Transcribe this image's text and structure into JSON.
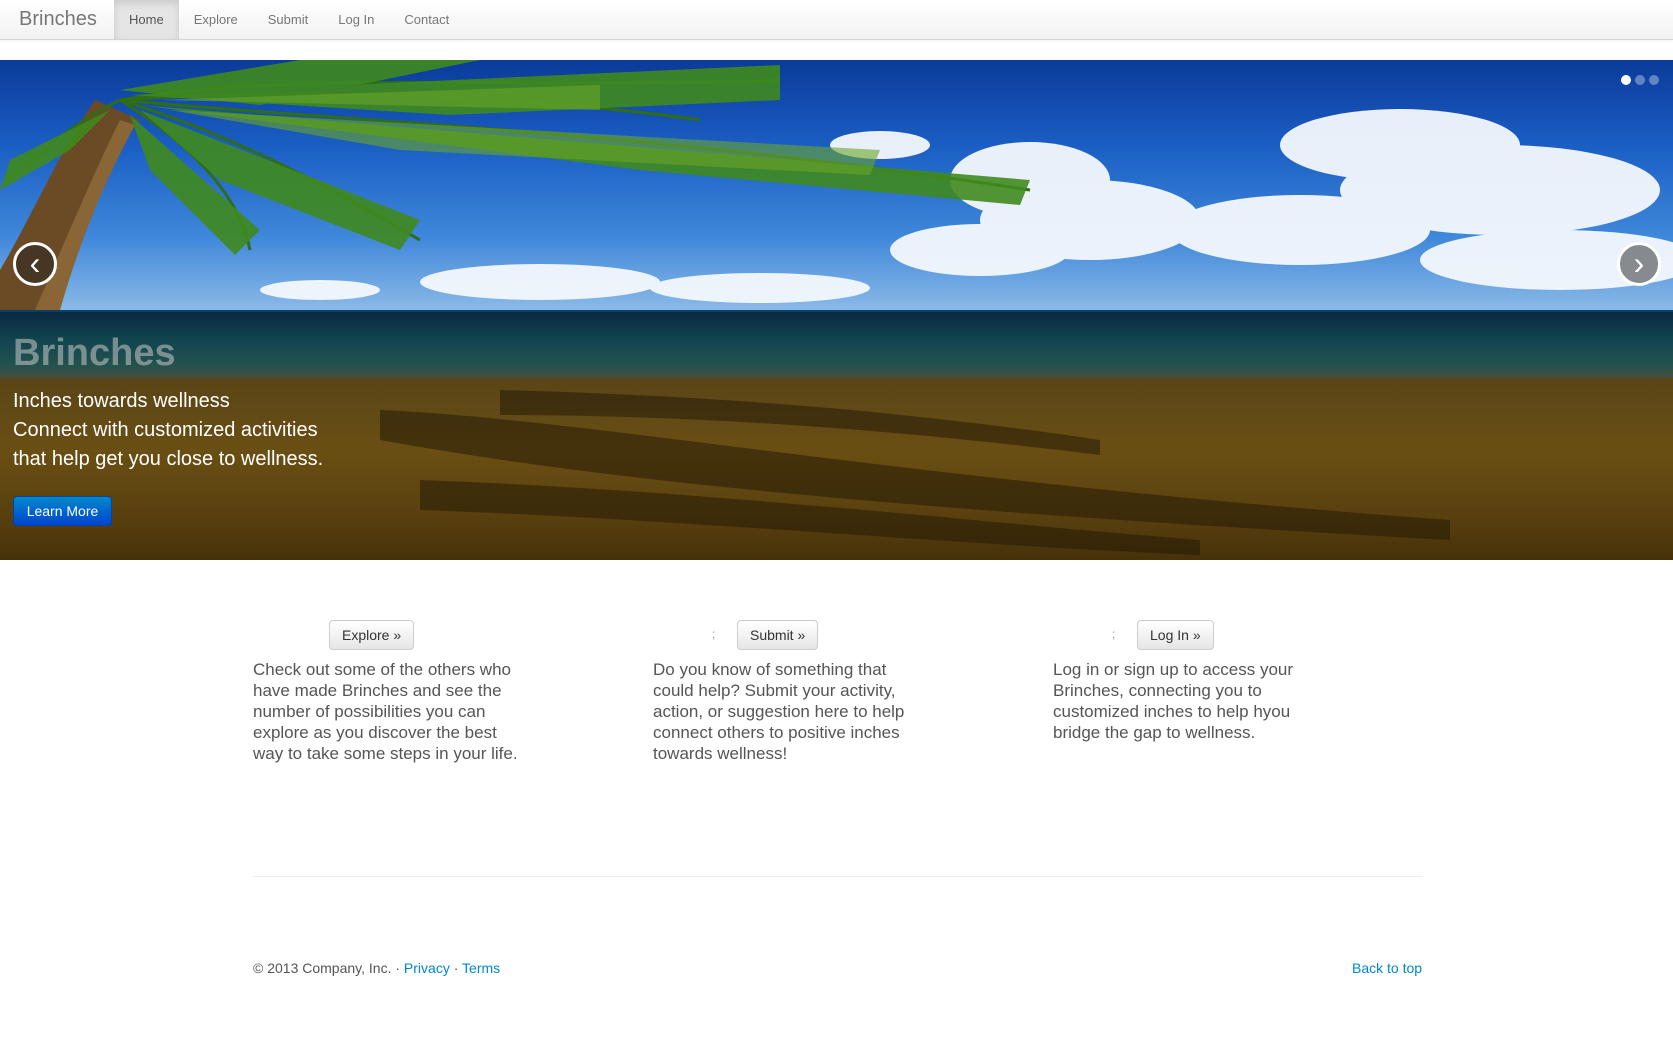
{
  "navbar": {
    "brand": "Brinches",
    "items": [
      {
        "label": "Home",
        "active": true
      },
      {
        "label": "Explore",
        "active": false
      },
      {
        "label": "Submit",
        "active": false
      },
      {
        "label": "Log In",
        "active": false
      },
      {
        "label": "Contact",
        "active": false
      }
    ]
  },
  "carousel": {
    "title": "Brinches",
    "lines": [
      "Inches towards wellness",
      "Connect with customized activities",
      "that help get you close to wellness."
    ],
    "button": "Learn More",
    "prev_glyph": "‹",
    "next_glyph": "›",
    "indicator_count": 3,
    "active_indicator": 1
  },
  "features": [
    {
      "button": "Explore »",
      "text": "Check out some of the others who have made Brinches and see the number of possibilities you can explore as you discover the best way to take some steps in your life."
    },
    {
      "semicolon": ";",
      "button": "Submit »",
      "text": "Do you know of something that could help? Submit your activity, action, or suggestion here to help connect others to positive inches towards wellness!"
    },
    {
      "semicolon": ";",
      "button": "Log In »",
      "text": "Log in or sign up to access your Brinches, connecting you to customized inches to help hyou bridge the gap to wellness."
    }
  ],
  "footer": {
    "copyright": "© 2013 Company, Inc.",
    "sep": "·",
    "privacy": "Privacy",
    "terms": "Terms",
    "back_to_top": "Back to top"
  },
  "colors": {
    "link": "#0088cc",
    "primary_button": "#0055cc",
    "sky": "#1b5fc4",
    "sand": "#a37a1f"
  }
}
